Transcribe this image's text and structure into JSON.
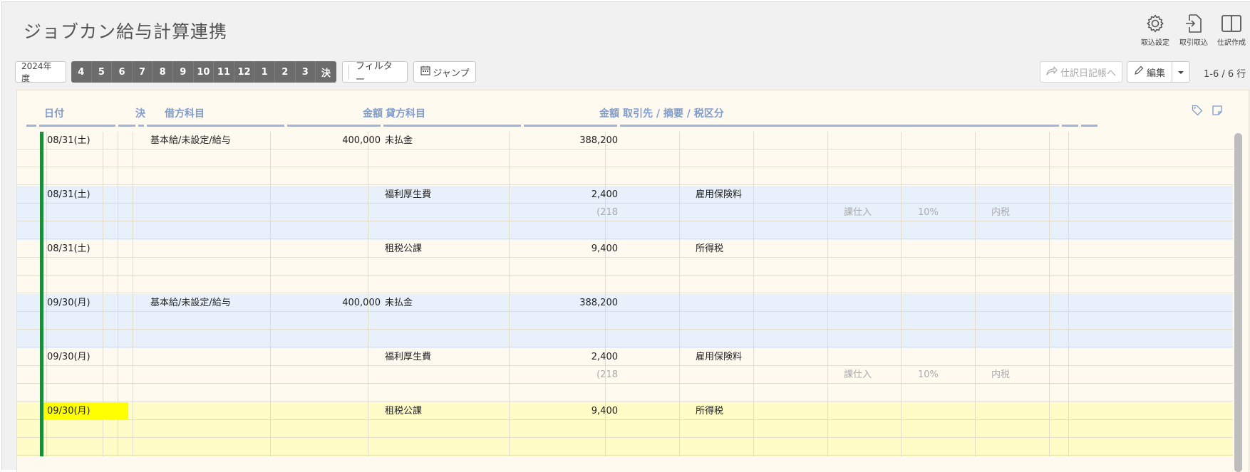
{
  "app": {
    "title": "ジョブカン給与計算連携",
    "tools": [
      {
        "label": "取込設定",
        "icon": "gear-icon"
      },
      {
        "label": "取引取込",
        "icon": "import-icon"
      },
      {
        "label": "仕訳作成",
        "icon": "split-view-icon"
      }
    ]
  },
  "toolbar": {
    "fiscal_year": "2024年度",
    "months": [
      "4",
      "5",
      "6",
      "7",
      "8",
      "9",
      "10",
      "11",
      "12",
      "1",
      "2",
      "3",
      "決"
    ],
    "filter": "フィルター",
    "jump": "ジャンプ",
    "journal_btn": "仕訳日記帳へ",
    "edit": "編集",
    "row_count": "1-6 / 6 行"
  },
  "columns": {
    "date": "日付",
    "closing": "決",
    "debit_account": "借方科目",
    "debit_amount": "金額",
    "credit_account": "貸方科目",
    "credit_amount": "金額",
    "partner": "取引先 / 摘要 / 税区分"
  },
  "entries": [
    {
      "date": "08/31(土)",
      "debit_account": "基本給/未設定/給与",
      "debit_amount": "400,000",
      "credit_account": "未払金",
      "credit_amount": "388,200",
      "memo": "",
      "tax_amount": "",
      "tax_class": "",
      "tax_rate": "",
      "tax_type": "",
      "bg": "#fffaf0",
      "date_bg": ""
    },
    {
      "date": "08/31(土)",
      "debit_account": "",
      "debit_amount": "",
      "credit_account": "福利厚生費",
      "credit_amount": "2,400",
      "memo": "雇用保険料",
      "tax_amount": "(218",
      "tax_class": "課仕入",
      "tax_rate": "10%",
      "tax_type": "内税",
      "bg": "#e8f0fb",
      "date_bg": ""
    },
    {
      "date": "08/31(土)",
      "debit_account": "",
      "debit_amount": "",
      "credit_account": "租税公課",
      "credit_amount": "9,400",
      "memo": "所得税",
      "tax_amount": "",
      "tax_class": "",
      "tax_rate": "",
      "tax_type": "",
      "bg": "#fffaf0",
      "date_bg": ""
    },
    {
      "date": "09/30(月)",
      "debit_account": "基本給/未設定/給与",
      "debit_amount": "400,000",
      "credit_account": "未払金",
      "credit_amount": "388,200",
      "memo": "",
      "tax_amount": "",
      "tax_class": "",
      "tax_rate": "",
      "tax_type": "",
      "bg": "#e8f0fb",
      "date_bg": ""
    },
    {
      "date": "09/30(月)",
      "debit_account": "",
      "debit_amount": "",
      "credit_account": "福利厚生費",
      "credit_amount": "2,400",
      "memo": "雇用保険料",
      "tax_amount": "(218",
      "tax_class": "課仕入",
      "tax_rate": "10%",
      "tax_type": "内税",
      "bg": "#fffaf0",
      "date_bg": ""
    },
    {
      "date": "09/30(月)",
      "debit_account": "",
      "debit_amount": "",
      "credit_account": "租税公課",
      "credit_amount": "9,400",
      "memo": "所得税",
      "tax_amount": "",
      "tax_class": "",
      "tax_rate": "",
      "tax_type": "",
      "bg": "#fffcc8",
      "date_bg": "#ffff00"
    }
  ]
}
